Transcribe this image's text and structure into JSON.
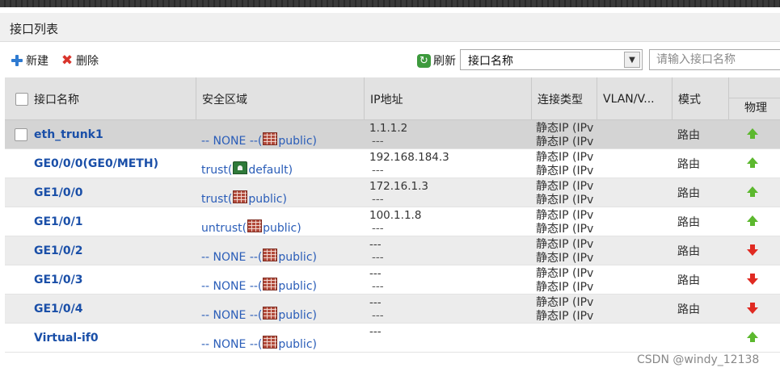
{
  "panel": {
    "title": "接口列表"
  },
  "toolbar": {
    "new_label": "新建",
    "delete_label": "删除",
    "refresh_label": "刷新",
    "filter_select_value": "接口名称",
    "search_placeholder": "请输入接口名称"
  },
  "table": {
    "headers": {
      "name": "接口名称",
      "zone": "安全区域",
      "ip": "IP地址",
      "conn": "连接类型",
      "vlan": "VLAN/V...",
      "mode": "模式",
      "phys": "物理"
    },
    "rows": [
      {
        "name": "eth_trunk1",
        "zone_prefix": "-- NONE --(",
        "zone_icon": "firewall-icon",
        "zone_suffix": "public)",
        "ip1": "1.1.1.2",
        "ip2": "---",
        "conn1": "静态IP (IPv",
        "conn2": "静态IP (IPv",
        "mode": "路由",
        "status": "up",
        "has_checkbox": true
      },
      {
        "name": "GE0/0/0(GE0/METH)",
        "zone_prefix": "trust(",
        "zone_icon": "trust-zone-icon",
        "zone_suffix": "default)",
        "ip1": "192.168.184.3",
        "ip2": "---",
        "conn1": "静态IP (IPv",
        "conn2": "静态IP (IPv",
        "mode": "路由",
        "status": "up",
        "has_checkbox": false
      },
      {
        "name": "GE1/0/0",
        "zone_prefix": "trust(",
        "zone_icon": "firewall-icon",
        "zone_suffix": "public)",
        "ip1": "172.16.1.3",
        "ip2": "---",
        "conn1": "静态IP (IPv",
        "conn2": "静态IP (IPv",
        "mode": "路由",
        "status": "up",
        "has_checkbox": false
      },
      {
        "name": "GE1/0/1",
        "zone_prefix": "untrust(",
        "zone_icon": "firewall-icon",
        "zone_suffix": "public)",
        "ip1": "100.1.1.8",
        "ip2": "---",
        "conn1": "静态IP (IPv",
        "conn2": "静态IP (IPv",
        "mode": "路由",
        "status": "up",
        "has_checkbox": false
      },
      {
        "name": "GE1/0/2",
        "zone_prefix": "-- NONE --(",
        "zone_icon": "firewall-icon",
        "zone_suffix": "public)",
        "ip1": "---",
        "ip2": "---",
        "conn1": "静态IP (IPv",
        "conn2": "静态IP (IPv",
        "mode": "路由",
        "status": "down",
        "has_checkbox": false
      },
      {
        "name": "GE1/0/3",
        "zone_prefix": "-- NONE --(",
        "zone_icon": "firewall-icon",
        "zone_suffix": "public)",
        "ip1": "---",
        "ip2": "---",
        "conn1": "静态IP (IPv",
        "conn2": "静态IP (IPv",
        "mode": "路由",
        "status": "down",
        "has_checkbox": false
      },
      {
        "name": "GE1/0/4",
        "zone_prefix": "-- NONE --(",
        "zone_icon": "firewall-icon",
        "zone_suffix": "public)",
        "ip1": "---",
        "ip2": "---",
        "conn1": "静态IP (IPv",
        "conn2": "静态IP (IPv",
        "mode": "路由",
        "status": "down",
        "has_checkbox": false
      },
      {
        "name": "Virtual-if0",
        "zone_prefix": "-- NONE --(",
        "zone_icon": "firewall-icon",
        "zone_suffix": "public)",
        "ip1": "---",
        "ip2": "",
        "conn1": "",
        "conn2": "",
        "mode": "",
        "status": "up",
        "has_checkbox": false
      }
    ]
  },
  "watermark": "CSDN @windy_12138"
}
